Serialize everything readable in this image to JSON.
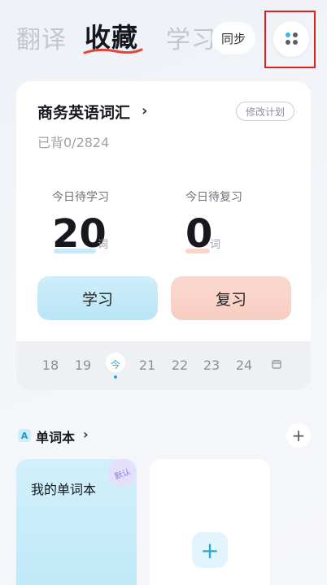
{
  "tabs": [
    {
      "label": "翻译",
      "active": false
    },
    {
      "label": "收藏",
      "active": true
    },
    {
      "label": "学习",
      "active": false
    }
  ],
  "header": {
    "sync_label": "同步",
    "menu_icon": "apps-dots-icon"
  },
  "plan": {
    "title": "商务英语词汇",
    "edit_label": "修改计划",
    "progress": "已背0/2824",
    "today_study": {
      "label": "今日待学习",
      "count": "20",
      "unit": "词"
    },
    "today_review": {
      "label": "今日待复习",
      "count": "0",
      "unit": "词"
    },
    "study_button": "学习",
    "review_button": "复习"
  },
  "dates": [
    "18",
    "19",
    "今",
    "21",
    "22",
    "23",
    "24"
  ],
  "calendar_icon": "calendar-icon",
  "notebooks": {
    "title": "单词本",
    "cards": [
      {
        "title": "我的单词本",
        "badge": "默认"
      }
    ],
    "new_icon": "plus-icon"
  },
  "colors": {
    "accent": "#26a9d8",
    "study": "#b9e5f7",
    "review": "#f8cdc2",
    "underline": "#e0463c",
    "highlight_box": "#e02020"
  }
}
